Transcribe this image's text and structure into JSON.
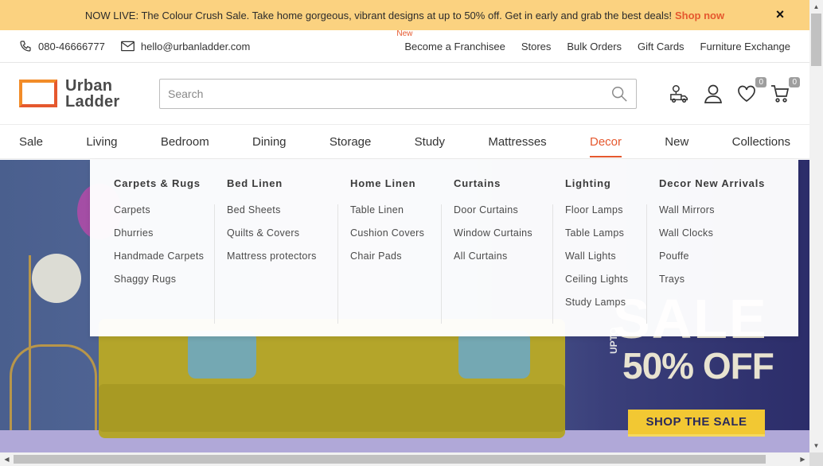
{
  "announcement": {
    "text": "NOW LIVE: The Colour Crush Sale. Take home gorgeous, vibrant designs at up to 50% off. Get in early and grab the best deals!",
    "cta": "Shop now",
    "close_icon": "×"
  },
  "utility": {
    "phone": "080-46666777",
    "email": "hello@urbanladder.com",
    "new_tag": "New",
    "links": [
      "Become a Franchisee",
      "Stores",
      "Bulk Orders",
      "Gift Cards",
      "Furniture Exchange"
    ]
  },
  "header": {
    "logo_line1": "Urban",
    "logo_line2": "Ladder",
    "search_placeholder": "Search",
    "wishlist_count": "0",
    "cart_count": "0"
  },
  "nav": {
    "items": [
      "Sale",
      "Living",
      "Bedroom",
      "Dining",
      "Storage",
      "Study",
      "Mattresses",
      "Decor",
      "New",
      "Collections"
    ],
    "active": "Decor"
  },
  "mega_menu": {
    "columns": [
      {
        "title": "Carpets & Rugs",
        "items": [
          "Carpets",
          "Dhurries",
          "Handmade Carpets",
          "Shaggy Rugs"
        ]
      },
      {
        "title": "Bed Linen",
        "items": [
          "Bed Sheets",
          "Quilts & Covers",
          "Mattress protectors"
        ]
      },
      {
        "title": "Home Linen",
        "items": [
          "Table Linen",
          "Cushion Covers",
          "Chair Pads"
        ]
      },
      {
        "title": "Curtains",
        "items": [
          "Door Curtains",
          "Window Curtains",
          "All Curtains"
        ]
      },
      {
        "title": "Lighting",
        "items": [
          "Floor Lamps",
          "Table Lamps",
          "Wall Lights",
          "Ceiling Lights",
          "Study Lamps"
        ]
      },
      {
        "title": "Decor New Arrivals",
        "items": [
          "Wall Mirrors",
          "Wall Clocks",
          "Pouffe",
          "Trays"
        ]
      }
    ]
  },
  "hero": {
    "sale_word": "SALE",
    "upto": "UPTO",
    "offer": "50% OFF",
    "cta": "SHOP THE SALE"
  },
  "colors": {
    "accent": "#e5582e",
    "announce_bg": "#fbd280",
    "cta_bg": "#f2c833"
  }
}
